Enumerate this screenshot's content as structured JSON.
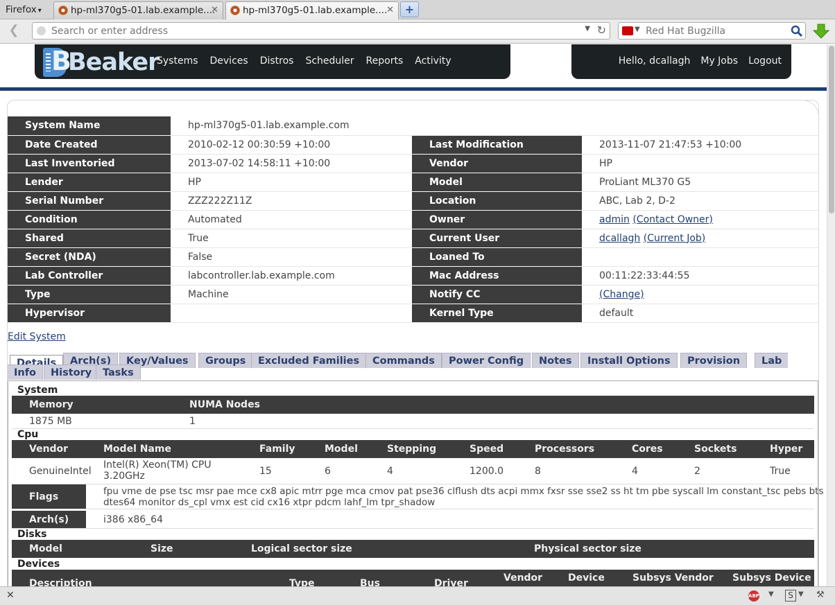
{
  "browser": {
    "menu_label": "Firefox",
    "tabs": [
      {
        "label": "hp-ml370g5-01.lab.example...."
      },
      {
        "label": "hp-ml370g5-01.lab.example...."
      }
    ],
    "url_placeholder": "Search or enter address",
    "search_placeholder": "Red Hat Bugzilla"
  },
  "header": {
    "logo_text": "Beaker",
    "nav": [
      "Systems",
      "Devices",
      "Distros",
      "Scheduler",
      "Reports",
      "Activity"
    ],
    "greeting": "Hello, dcallagh",
    "my_jobs": "My Jobs",
    "logout": "Logout"
  },
  "system": {
    "name_label": "System Name",
    "name_value": "hp-ml370g5-01.lab.example.com",
    "left": [
      {
        "label": "Date Created",
        "value": "2010-02-12 00:30:59 +10:00"
      },
      {
        "label": "Last Inventoried",
        "value": "2013-07-02 14:58:11 +10:00"
      },
      {
        "label": "Lender",
        "value": "HP"
      },
      {
        "label": "Serial Number",
        "value": "ZZZ222Z11Z"
      },
      {
        "label": "Condition",
        "value": "Automated"
      },
      {
        "label": "Shared",
        "value": "True"
      },
      {
        "label": "Secret (NDA)",
        "value": "False"
      },
      {
        "label": "Lab Controller",
        "value": "labcontroller.lab.example.com"
      },
      {
        "label": "Type",
        "value": "Machine"
      },
      {
        "label": "Hypervisor",
        "value": ""
      }
    ],
    "right": [
      {
        "label": "Last Modification",
        "value": "2013-11-07 21:47:53 +10:00"
      },
      {
        "label": "Vendor",
        "value": "HP"
      },
      {
        "label": "Model",
        "value": "ProLiant ML370 G5"
      },
      {
        "label": "Location",
        "value": "ABC, Lab 2, D-2"
      },
      {
        "label": "Owner",
        "link1": "admin",
        "link2": "(Contact Owner)"
      },
      {
        "label": "Current User",
        "link1": "dcallagh",
        "link2": "(Current Job)"
      },
      {
        "label": "Loaned To",
        "value": ""
      },
      {
        "label": "Mac Address",
        "value": "00:11:22:33:44:55"
      },
      {
        "label": "Notify CC",
        "link1": "(Change)"
      },
      {
        "label": "Kernel Type",
        "value": "default"
      }
    ]
  },
  "edit_system": "Edit System",
  "detail_tabs": [
    "Details",
    "Arch(s)",
    "Key/Values",
    "Groups",
    "Excluded Families",
    "Commands",
    "Power Config",
    "Notes",
    "Install Options",
    "Provision",
    "Lab",
    "Info",
    "History",
    "Tasks"
  ],
  "details": {
    "system_heading": "System",
    "system_cols": [
      "Memory",
      "NUMA Nodes"
    ],
    "system_vals": [
      "1875 MB",
      "1"
    ],
    "cpu_heading": "Cpu",
    "cpu_cols": [
      "Vendor",
      "Model Name",
      "Family",
      "Model",
      "Stepping",
      "Speed",
      "Processors",
      "Cores",
      "Sockets",
      "Hyper"
    ],
    "cpu_vals": [
      "GenuineIntel",
      "Intel(R) Xeon(TM) CPU",
      "3.20GHz",
      "15",
      "6",
      "4",
      "1200.0",
      "8",
      "4",
      "2",
      "True"
    ],
    "flags_label": "Flags",
    "flags_line1": "fpu vme de pse tsc msr pae mce cx8 apic mtrr pge mca cmov pat pse36 clflush dts acpi mmx fxsr sse sse2 ss ht tm pbe syscall lm constant_tsc pebs bts pni",
    "flags_line2": "dtes64 monitor ds_cpl vmx est cid cx16 xtpr pdcm lahf_lm tpr_shadow",
    "arch_label": "Arch(s)",
    "arch_value": "i386 x86_64",
    "disks_heading": "Disks",
    "disk_cols": [
      "Model",
      "Size",
      "Logical sector size",
      "Physical sector size"
    ],
    "devices_heading": "Devices",
    "device_cols": [
      "Description",
      "Type",
      "Bus",
      "Driver",
      "Vendor",
      "Device",
      "Subsys Vendor",
      "Subsys Device"
    ]
  }
}
